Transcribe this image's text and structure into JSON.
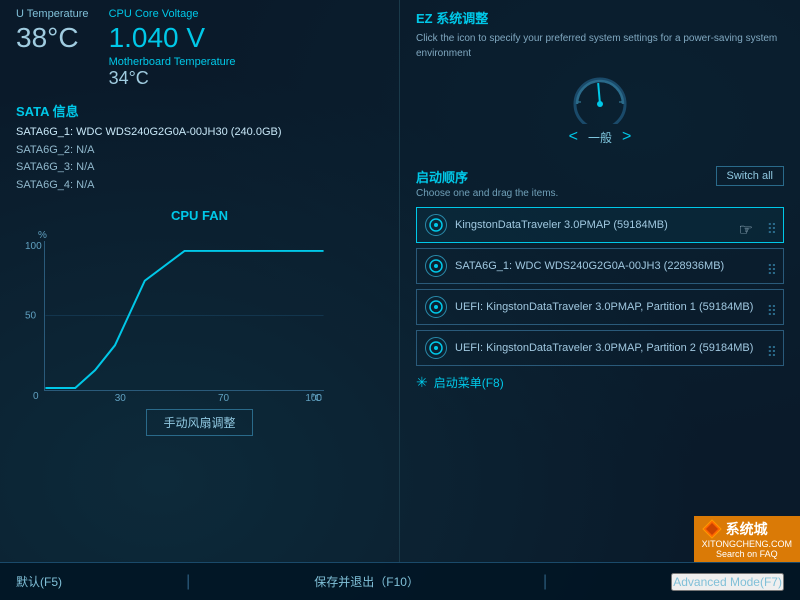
{
  "left": {
    "cpu_temp_label": "U Temperature",
    "cpu_temp_value": "38°C",
    "cpu_core_label": "CPU Core Voltage",
    "voltage_value": "1.040 V",
    "mb_temp_label": "Motherboard Temperature",
    "mb_temp_value": "34°C",
    "sata_title": "SATA 信息",
    "sata_items": [
      {
        "label": "SATA6G_1: WDC WDS240G2G0A-00JH30 (240.0GB)",
        "highlighted": true
      },
      {
        "label": "SATA6G_2: N/A",
        "highlighted": false
      },
      {
        "label": "SATA6G_3: N/A",
        "highlighted": false
      },
      {
        "label": "SATA6G_4: N/A",
        "highlighted": false
      }
    ],
    "cpu_fan_title": "CPU FAN",
    "cpu_fan_ylabel": "%",
    "cpu_fan_y100": "100",
    "cpu_fan_y50": "50",
    "cpu_fan_y0": "0",
    "cpu_fan_x30": "30",
    "cpu_fan_x70": "70",
    "cpu_fan_x100": "100",
    "cpu_fan_xlabel": "°C",
    "fan_control_btn": "手动风扇调整"
  },
  "right": {
    "ez_title": "EZ 系统调整",
    "ez_desc": "Click the icon to specify your preferred system settings for a power-saving system environment",
    "gauge_label": "一般",
    "gauge_prev": "<",
    "gauge_next": ">",
    "boot_title": "启动顺序",
    "boot_subtitle": "Choose one and drag the items.",
    "switch_all_btn": "Switch all",
    "boot_items": [
      {
        "text": "KingstonDataTraveler 3.0PMAP (59184MB)",
        "active": true
      },
      {
        "text": "SATA6G_1: WDC WDS240G2G0A-00JH3 (228936MB)",
        "active": false
      },
      {
        "text": "UEFI: KingstonDataTraveler 3.0PMAP, Partition 1 (59184MB)",
        "active": false
      },
      {
        "text": "UEFI: KingstonDataTraveler 3.0PMAP, Partition 2 (59184MB)",
        "active": false
      }
    ],
    "boot_menu_label": "启动菜单(F8)"
  },
  "bottom": {
    "default_btn": "默认(F5)",
    "save_exit_btn": "保存并退出（F10）",
    "advanced_mode_btn": "Advanced Mode(F7)"
  },
  "watermark": {
    "site": "XITONGCHENG.COM",
    "label": "系统城",
    "search_text": "Search on FAQ"
  }
}
